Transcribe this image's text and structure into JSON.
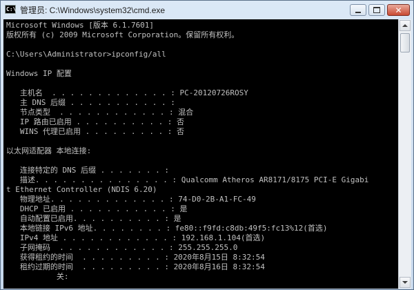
{
  "window": {
    "title": "管理员: C:\\Windows\\system32\\cmd.exe",
    "app_icon_text": "C:\\"
  },
  "console": {
    "lines": [
      "Microsoft Windows [版本 6.1.7601]",
      "版权所有 (c) 2009 Microsoft Corporation。保留所有权利。",
      "",
      "C:\\Users\\Administrator>ipconfig/all",
      "",
      "Windows IP 配置",
      "",
      "   主机名  . . . . . . . . . . . . . : PC-20120726ROSY",
      "   主 DNS 后缀 . . . . . . . . . . . :",
      "   节点类型  . . . . . . . . . . . . : 混合",
      "   IP 路由已启用 . . . . . . . . . . : 否",
      "   WINS 代理已启用 . . . . . . . . . : 否",
      "",
      "以太网适配器 本地连接:",
      "",
      "   连接特定的 DNS 后缀 . . . . . . . :",
      "   描述. . . . . . . . . . . . . . . : Qualcomm Atheros AR8171/8175 PCI-E Gigabi",
      "t Ethernet Controller (NDIS 6.20)",
      "   物理地址. . . . . . . . . . . . . : 74-D0-2B-A1-FC-49",
      "   DHCP 已启用 . . . . . . . . . . . : 是",
      "   自动配置已启用. . . . . . . . . . : 是",
      "   本地链接 IPv6 地址. . . . . . . . : fe80::f9fd:c8db:49f5:fc13%12(首选)",
      "   IPv4 地址 . . . . . . . . . . . . : 192.168.1.104(首选)",
      "   子网掩码  . . . . . . . . . . . . : 255.255.255.0",
      "   获得租约的时间  . . . . . . . . . : 2020年8月15日 8:32:54",
      "   租约过期的时间  . . . . . . . . . : 2020年8月16日 8:32:54",
      "           关:"
    ]
  },
  "colors": {
    "console_bg": "#000000",
    "console_fg": "#c0c0c0",
    "close_button": "#c94a32"
  }
}
